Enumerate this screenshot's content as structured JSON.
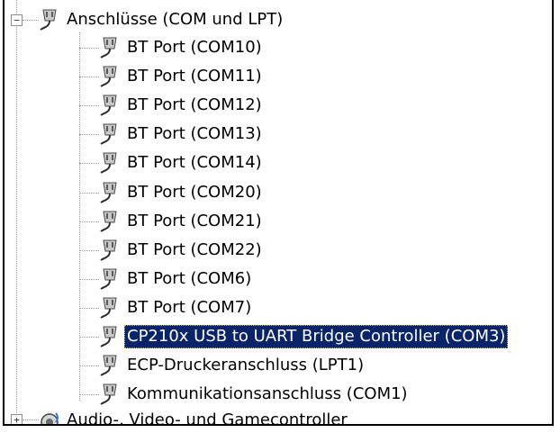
{
  "tree": {
    "category": {
      "label": "Anschlüsse (COM und LPT)",
      "expander": "−",
      "icon": "port-connector-icon"
    },
    "children": [
      {
        "label": "BT Port (COM10)",
        "icon": "port-connector-icon"
      },
      {
        "label": "BT Port (COM11)",
        "icon": "port-connector-icon"
      },
      {
        "label": "BT Port (COM12)",
        "icon": "port-connector-icon"
      },
      {
        "label": "BT Port (COM13)",
        "icon": "port-connector-icon"
      },
      {
        "label": "BT Port (COM14)",
        "icon": "port-connector-icon"
      },
      {
        "label": "BT Port (COM20)",
        "icon": "port-connector-icon"
      },
      {
        "label": "BT Port (COM21)",
        "icon": "port-connector-icon"
      },
      {
        "label": "BT Port (COM22)",
        "icon": "port-connector-icon"
      },
      {
        "label": "BT Port (COM6)",
        "icon": "port-connector-icon"
      },
      {
        "label": "BT Port (COM7)",
        "icon": "port-connector-icon"
      },
      {
        "label": "CP210x USB to UART Bridge Controller (COM3)",
        "icon": "port-connector-icon",
        "selected": true
      },
      {
        "label": "ECP-Druckeranschluss (LPT1)",
        "icon": "port-connector-icon"
      },
      {
        "label": "Kommunikationsanschluss (COM1)",
        "icon": "port-connector-icon"
      }
    ],
    "next_category": {
      "label": "Audio-, Video- und Gamecontroller",
      "expander": "+",
      "icon": "speaker-icon"
    }
  },
  "colors": {
    "selection_bg": "#0a246a",
    "selection_text": "#ffffff",
    "tree_lines": "#9a9a9a"
  }
}
